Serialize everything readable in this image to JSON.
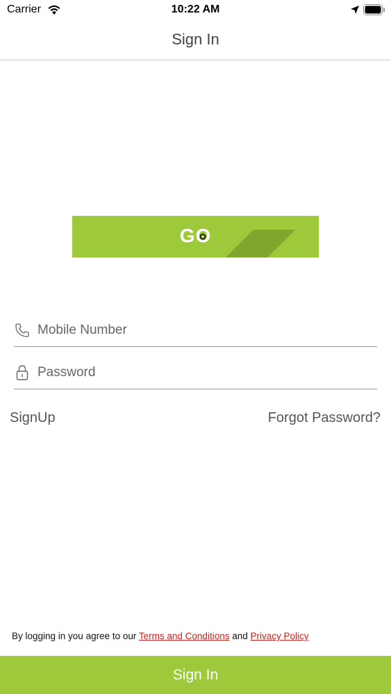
{
  "status_bar": {
    "carrier": "Carrier",
    "time": "10:22 AM"
  },
  "nav": {
    "title": "Sign In"
  },
  "logo": {
    "text": "GO",
    "color": "#9ec93b"
  },
  "form": {
    "mobile": {
      "placeholder": "Mobile Number",
      "value": ""
    },
    "password": {
      "placeholder": "Password",
      "value": ""
    }
  },
  "links": {
    "signup": "SignUp",
    "forgot": "Forgot Password?"
  },
  "agreement": {
    "prefix": "By logging in you agree to our ",
    "terms": "Terms and Conditions",
    "joiner": " and ",
    "privacy": "Privacy Policy",
    "link_color": "#d0201b"
  },
  "signin_button": {
    "label": "Sign In",
    "color": "#9ec93b"
  }
}
